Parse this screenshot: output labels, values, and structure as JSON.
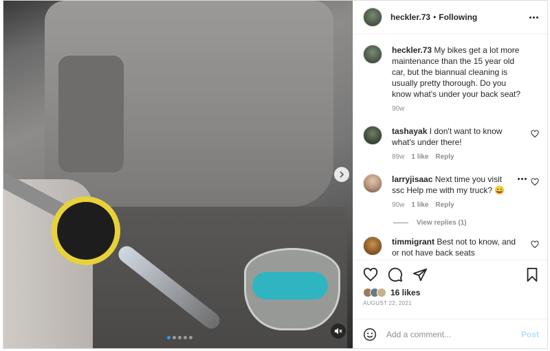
{
  "post": {
    "author": "heckler.73",
    "separator": "•",
    "follow_status": "Following"
  },
  "caption": {
    "username": "heckler.73",
    "text": "My bikes get a lot more maintenance than the 15 year old car, but the biannual cleaning is usually pretty thorough. Do you know what's under your back seat?",
    "age": "90w"
  },
  "comments": [
    {
      "username": "tashayak",
      "text": "I don't want to know what's under there!",
      "age": "89w",
      "likes": "1 like",
      "reply": "Reply"
    },
    {
      "username": "larryjisaac",
      "text": "Next time you visit ssc Help me with my truck? 😄",
      "age": "90w",
      "likes": "1 like",
      "reply": "Reply",
      "view_replies": "View replies (1)"
    },
    {
      "username": "timmigrant",
      "text": "Best not to know, and or not have back seats"
    }
  ],
  "engagement": {
    "likes": "16 likes",
    "date": "AUGUST 22, 2021"
  },
  "composer": {
    "placeholder": "Add a comment...",
    "post_label": "Post"
  },
  "carousel": {
    "slide_count": 5,
    "active_index": 0
  },
  "colors": {
    "link_blue": "#3897f0",
    "post_disabled": "#b2dffc",
    "muted_text": "#8e8e8e"
  },
  "icons": [
    "more-icon",
    "heart-icon",
    "comment-icon",
    "share-icon",
    "save-icon",
    "emoji-icon",
    "next-arrow-icon",
    "mute-icon"
  ]
}
